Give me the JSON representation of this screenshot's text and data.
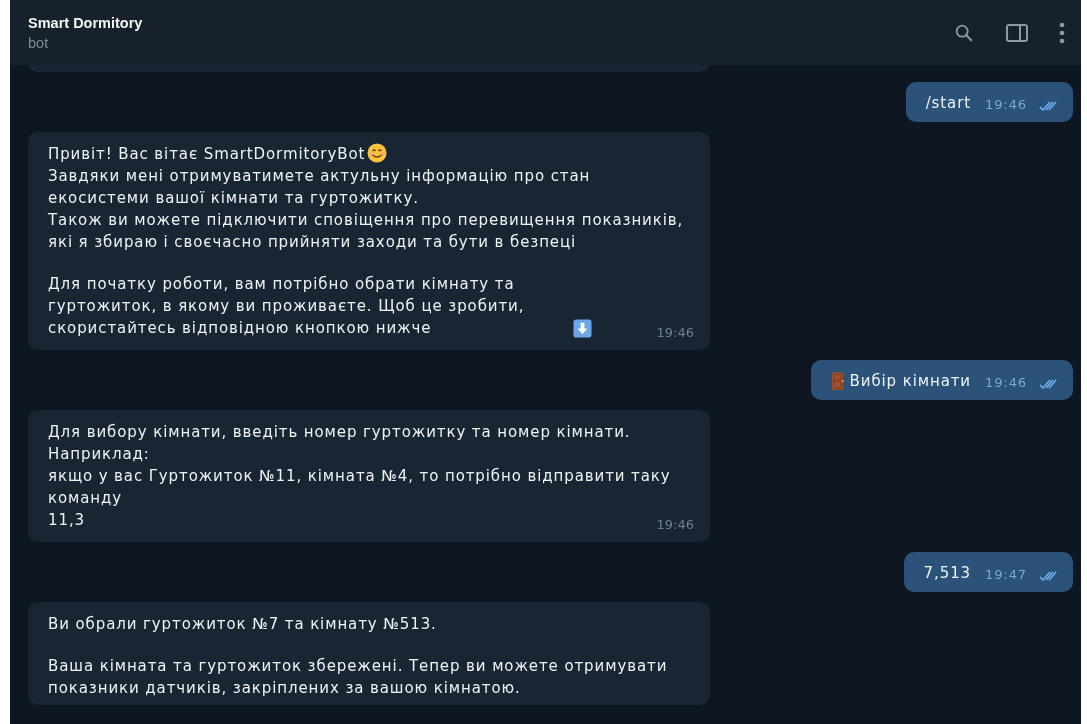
{
  "header": {
    "title": "Smart Dormitory",
    "subtitle": "bot"
  },
  "messages": [
    {
      "kind": "fragment"
    },
    {
      "kind": "outgoing",
      "blocks": [
        [
          {
            "text": "/start",
            "kind": "plain"
          }
        ]
      ],
      "time": "19:46",
      "read": true
    },
    {
      "kind": "incoming",
      "blocks": [
        [
          {
            "text": "Привіт! Вас вітає SmartDormitoryBot",
            "kind": "smiley"
          },
          {
            "text": "Завдяки мені отримуватимете актульну інформацію про стан екосистеми вашої кімнати та гуртожитку.",
            "kind": "plain"
          },
          {
            "text": "Також ви можете підключити сповіщення про перевищення показників, які я збираю і своєчасно прийняти заходи та бути в безпеці",
            "kind": "plain"
          }
        ],
        [
          {
            "text": "Для початку роботи, вам потрібно обрати кімнату та гуртожиток, в якому ви проживаєте. Щоб це зробити, скористайтесь відповідною кнопкою нижче",
            "kind": "arrow"
          }
        ]
      ],
      "time": "19:46"
    },
    {
      "kind": "outgoing",
      "blocks": [
        [
          {
            "text": "Вибір кімнати",
            "kind": "door"
          }
        ]
      ],
      "time": "19:46",
      "read": true
    },
    {
      "kind": "incoming",
      "blocks": [
        [
          {
            "text": "Для вибору кімнати, введіть номер гуртожитку та номер кімнати. Наприклад:",
            "kind": "plain"
          },
          {
            "text": "якщо у вас Гуртожиток №11, кімната №4, то потрібно відправити таку команду",
            "kind": "plain"
          },
          {
            "text": "11,3",
            "kind": "plain"
          }
        ]
      ],
      "time": "19:46"
    },
    {
      "kind": "outgoing",
      "blocks": [
        [
          {
            "text": "7,513",
            "kind": "plain"
          }
        ]
      ],
      "time": "19:47",
      "read": true
    },
    {
      "kind": "incoming",
      "blocks": [
        [
          {
            "text": "Ви обрали гуртожиток №7 та кімнату №513.",
            "kind": "plain"
          }
        ],
        [
          {
            "text": "Ваша кімната та гуртожиток збережені. Тепер ви можете отримувати показники датчиків, закріплених за вашою кімнатою.",
            "kind": "plain"
          }
        ]
      ]
    }
  ]
}
